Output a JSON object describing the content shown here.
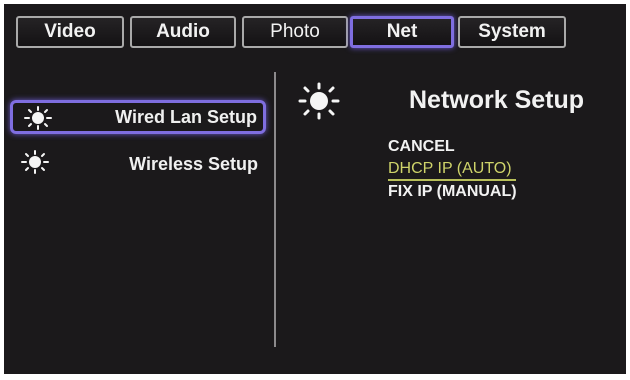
{
  "tabs": [
    {
      "label": "Video",
      "active": false
    },
    {
      "label": "Audio",
      "active": false
    },
    {
      "label": "Photo",
      "active": false
    },
    {
      "label": "Net",
      "active": true
    },
    {
      "label": "System",
      "active": false
    }
  ],
  "sidebar": {
    "items": [
      {
        "label": "Wired Lan Setup",
        "icon": "sun-icon",
        "selected": true
      },
      {
        "label": "Wireless Setup",
        "icon": "sun-icon",
        "selected": false
      }
    ]
  },
  "panel": {
    "icon": "sun-icon",
    "title": "Network Setup",
    "options": [
      {
        "label": "CANCEL",
        "selected": false
      },
      {
        "label": "DHCP IP (AUTO)",
        "selected": true
      },
      {
        "label": "FIX IP (MANUAL)",
        "selected": false
      }
    ]
  },
  "colors": {
    "background": "#1b191b",
    "highlight": "#7f6ee0",
    "selected_text": "#cfd46a",
    "text": "#f2f2f2"
  }
}
